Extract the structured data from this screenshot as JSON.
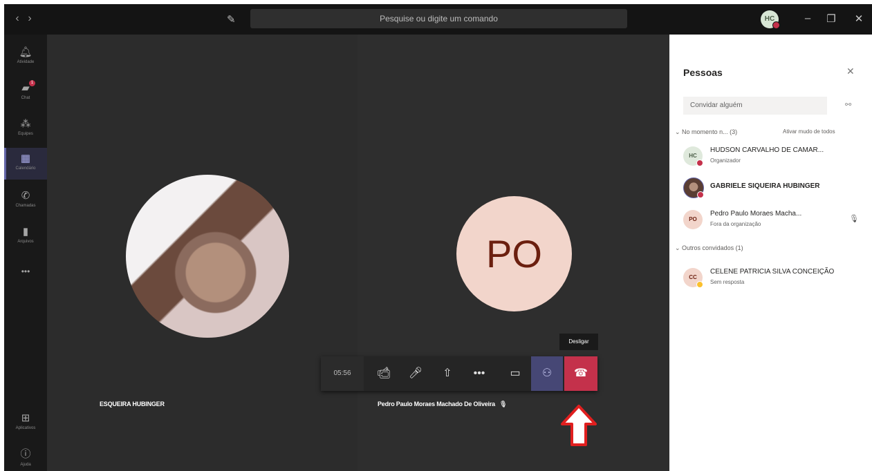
{
  "titlebar": {
    "search_placeholder": "Pesquise ou digite um comando",
    "user_initials": "HC"
  },
  "rail": [
    {
      "label": "Atividade",
      "icon": "bell-icon"
    },
    {
      "label": "Chat",
      "icon": "chat-icon",
      "badge": "1"
    },
    {
      "label": "Equipes",
      "icon": "teams-icon"
    },
    {
      "label": "Calendário",
      "icon": "calendar-icon",
      "active": true
    },
    {
      "label": "Chamadas",
      "icon": "phone-icon"
    },
    {
      "label": "Arquivos",
      "icon": "files-icon"
    },
    {
      "label": "Aplicativos",
      "icon": "apps-icon"
    },
    {
      "label": "Ajuda",
      "icon": "help-icon"
    }
  ],
  "stage": {
    "left_name": "ESQUEIRA HUBINGER",
    "right_initials": "PO",
    "right_name": "Pedro Paulo Moraes Machado De Oliveira"
  },
  "callbar": {
    "timer": "05:56",
    "hangup_tooltip": "Desligar"
  },
  "panel": {
    "title": "Pessoas",
    "invite_placeholder": "Convidar alguém",
    "section_current": "No momento n...  (3)",
    "mute_all": "Ativar mudo de todos",
    "section_other": "Outros convidados (1)",
    "people": [
      {
        "initials": "HC",
        "name": "HUDSON CARVALHO DE CAMAR...",
        "role": "Organizador",
        "status_color": "#c4314b",
        "avatar_bg": "#dfe9dc",
        "avatar_fg": "#4c5e48"
      },
      {
        "initials": "",
        "name": "GABRIELE SIQUEIRA HUBINGER",
        "role": "",
        "status_color": "#c4314b",
        "avatar_bg": "#8b6b5e",
        "avatar_fg": "#fff"
      },
      {
        "initials": "PO",
        "name": "Pedro Paulo Moraes Macha...",
        "role": "Fora da organização",
        "status_color": "",
        "avatar_bg": "#f2d5cb",
        "avatar_fg": "#6b1f0f"
      },
      {
        "initials": "CC",
        "name": "CELENE PATRICIA SILVA CONCEIÇÃO",
        "role": "Sem resposta",
        "status_color": "#fbc02d",
        "avatar_bg": "#f2d5cb",
        "avatar_fg": "#6b1f0f"
      }
    ]
  },
  "colors": {
    "accent": "#6264a7",
    "hangup": "#c4314b",
    "arrow": "#e01f1f"
  }
}
